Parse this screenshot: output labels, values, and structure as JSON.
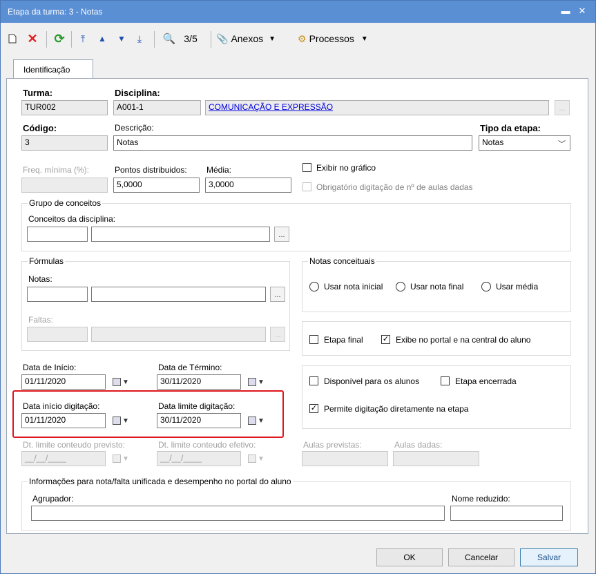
{
  "window": {
    "title": "Etapa da turma: 3 - Notas"
  },
  "toolbar": {
    "record_counter": "3/5",
    "attachments_label": "Anexos",
    "processes_label": "Processos"
  },
  "tabs": [
    "Identificação"
  ],
  "turma": {
    "label": "Turma:",
    "value": "TUR002"
  },
  "disciplina": {
    "label": "Disciplina:",
    "code": "A001-1",
    "name": "COMUNICAÇÃO E EXPRESSÃO"
  },
  "codigo": {
    "label": "Código:",
    "value": "3"
  },
  "descricao": {
    "label": "Descrição:",
    "value": "Notas"
  },
  "tipo_etapa": {
    "label": "Tipo da etapa:",
    "value": "Notas"
  },
  "freq_minima": {
    "label": "Freq. mínima (%):",
    "value": ""
  },
  "pontos": {
    "label": "Pontos distribuidos:",
    "value": "5,0000"
  },
  "media": {
    "label": "Média:",
    "value": "3,0000"
  },
  "exibir_grafico": {
    "label": "Exibir no gráfico",
    "checked": false
  },
  "obrigatorio": {
    "label": "Obrigatório digitação de nº de aulas dadas",
    "checked": false
  },
  "grupo_conceitos": {
    "title": "Grupo de conceitos",
    "label": "Conceitos da disciplina:"
  },
  "formulas": {
    "title": "Fórmulas",
    "notas_label": "Notas:",
    "faltas_label": "Faltas:"
  },
  "notas_conceituais": {
    "title": "Notas conceituais",
    "options": [
      "Usar nota inicial",
      "Usar nota final",
      "Usar média"
    ]
  },
  "etapa_final": {
    "label": "Etapa final",
    "checked": false
  },
  "exibe_portal": {
    "label": "Exibe no portal e na central do aluno",
    "checked": true
  },
  "disponivel_alunos": {
    "label": "Disponível para os alunos",
    "checked": false
  },
  "etapa_encerrada": {
    "label": "Etapa encerrada",
    "checked": false
  },
  "permite_digitacao": {
    "label": "Permite digitação diretamente na etapa",
    "checked": true
  },
  "data_inicio": {
    "label": "Data de Início:",
    "value": "01/11/2020"
  },
  "data_termino": {
    "label": "Data de Término:",
    "value": "30/11/2020"
  },
  "data_inicio_digitacao": {
    "label": "Data início digitação:",
    "value": "01/11/2020"
  },
  "data_limite_digitacao": {
    "label": "Data limite digitação:",
    "value": "30/11/2020"
  },
  "dt_limite_previsto": {
    "label": "Dt. limite conteudo previsto:",
    "value": "__/__/____"
  },
  "dt_limite_efetivo": {
    "label": "Dt. limite conteudo efetivo:",
    "value": "__/__/____"
  },
  "aulas_previstas": {
    "label": "Aulas previstas:",
    "value": ""
  },
  "aulas_dadas": {
    "label": "Aulas dadas:",
    "value": ""
  },
  "info_unificada": {
    "title": "Informações para nota/falta unificada e desempenho no portal do aluno",
    "agrupador_label": "Agrupador:",
    "nome_reduzido_label": "Nome reduzido:"
  },
  "buttons": {
    "ok": "OK",
    "cancel": "Cancelar",
    "save": "Salvar"
  },
  "colors": {
    "title_bar": "#5b8fd4",
    "highlight": "#e0141c",
    "link": "#0000e0"
  }
}
